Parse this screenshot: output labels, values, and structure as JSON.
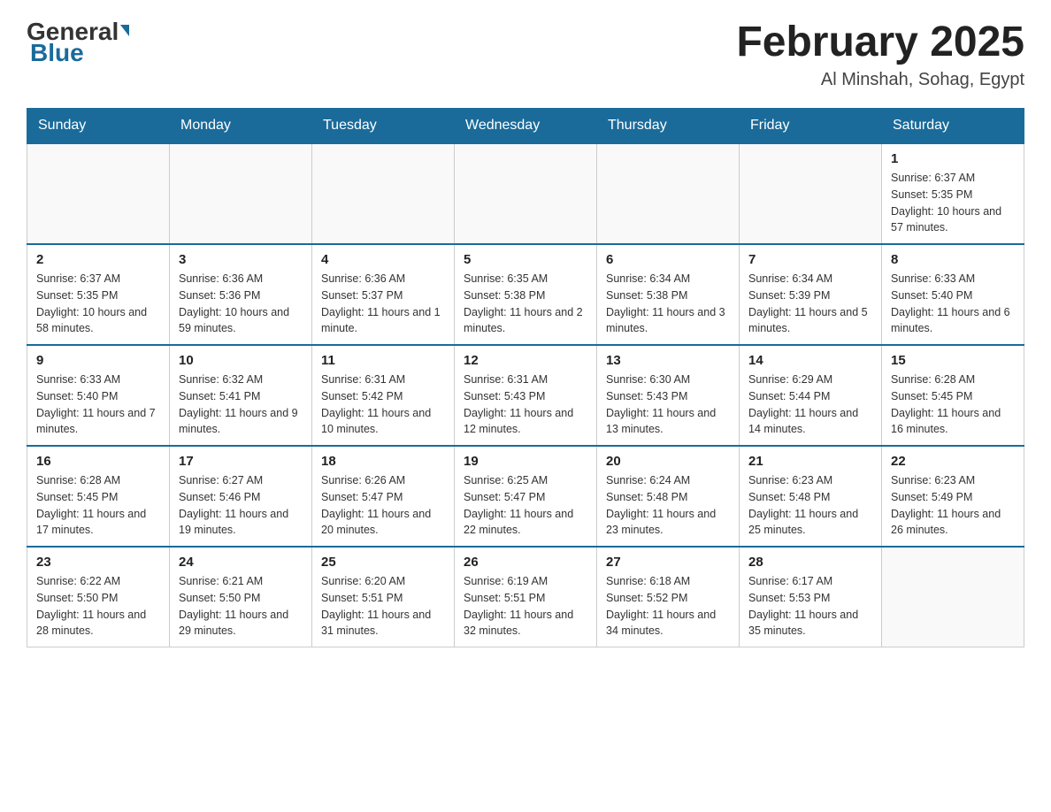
{
  "header": {
    "logo_general": "General",
    "logo_blue": "Blue",
    "month_year": "February 2025",
    "location": "Al Minshah, Sohag, Egypt"
  },
  "days_of_week": [
    "Sunday",
    "Monday",
    "Tuesday",
    "Wednesday",
    "Thursday",
    "Friday",
    "Saturday"
  ],
  "weeks": [
    [
      {
        "day": "",
        "info": ""
      },
      {
        "day": "",
        "info": ""
      },
      {
        "day": "",
        "info": ""
      },
      {
        "day": "",
        "info": ""
      },
      {
        "day": "",
        "info": ""
      },
      {
        "day": "",
        "info": ""
      },
      {
        "day": "1",
        "info": "Sunrise: 6:37 AM\nSunset: 5:35 PM\nDaylight: 10 hours and 57 minutes."
      }
    ],
    [
      {
        "day": "2",
        "info": "Sunrise: 6:37 AM\nSunset: 5:35 PM\nDaylight: 10 hours and 58 minutes."
      },
      {
        "day": "3",
        "info": "Sunrise: 6:36 AM\nSunset: 5:36 PM\nDaylight: 10 hours and 59 minutes."
      },
      {
        "day": "4",
        "info": "Sunrise: 6:36 AM\nSunset: 5:37 PM\nDaylight: 11 hours and 1 minute."
      },
      {
        "day": "5",
        "info": "Sunrise: 6:35 AM\nSunset: 5:38 PM\nDaylight: 11 hours and 2 minutes."
      },
      {
        "day": "6",
        "info": "Sunrise: 6:34 AM\nSunset: 5:38 PM\nDaylight: 11 hours and 3 minutes."
      },
      {
        "day": "7",
        "info": "Sunrise: 6:34 AM\nSunset: 5:39 PM\nDaylight: 11 hours and 5 minutes."
      },
      {
        "day": "8",
        "info": "Sunrise: 6:33 AM\nSunset: 5:40 PM\nDaylight: 11 hours and 6 minutes."
      }
    ],
    [
      {
        "day": "9",
        "info": "Sunrise: 6:33 AM\nSunset: 5:40 PM\nDaylight: 11 hours and 7 minutes."
      },
      {
        "day": "10",
        "info": "Sunrise: 6:32 AM\nSunset: 5:41 PM\nDaylight: 11 hours and 9 minutes."
      },
      {
        "day": "11",
        "info": "Sunrise: 6:31 AM\nSunset: 5:42 PM\nDaylight: 11 hours and 10 minutes."
      },
      {
        "day": "12",
        "info": "Sunrise: 6:31 AM\nSunset: 5:43 PM\nDaylight: 11 hours and 12 minutes."
      },
      {
        "day": "13",
        "info": "Sunrise: 6:30 AM\nSunset: 5:43 PM\nDaylight: 11 hours and 13 minutes."
      },
      {
        "day": "14",
        "info": "Sunrise: 6:29 AM\nSunset: 5:44 PM\nDaylight: 11 hours and 14 minutes."
      },
      {
        "day": "15",
        "info": "Sunrise: 6:28 AM\nSunset: 5:45 PM\nDaylight: 11 hours and 16 minutes."
      }
    ],
    [
      {
        "day": "16",
        "info": "Sunrise: 6:28 AM\nSunset: 5:45 PM\nDaylight: 11 hours and 17 minutes."
      },
      {
        "day": "17",
        "info": "Sunrise: 6:27 AM\nSunset: 5:46 PM\nDaylight: 11 hours and 19 minutes."
      },
      {
        "day": "18",
        "info": "Sunrise: 6:26 AM\nSunset: 5:47 PM\nDaylight: 11 hours and 20 minutes."
      },
      {
        "day": "19",
        "info": "Sunrise: 6:25 AM\nSunset: 5:47 PM\nDaylight: 11 hours and 22 minutes."
      },
      {
        "day": "20",
        "info": "Sunrise: 6:24 AM\nSunset: 5:48 PM\nDaylight: 11 hours and 23 minutes."
      },
      {
        "day": "21",
        "info": "Sunrise: 6:23 AM\nSunset: 5:48 PM\nDaylight: 11 hours and 25 minutes."
      },
      {
        "day": "22",
        "info": "Sunrise: 6:23 AM\nSunset: 5:49 PM\nDaylight: 11 hours and 26 minutes."
      }
    ],
    [
      {
        "day": "23",
        "info": "Sunrise: 6:22 AM\nSunset: 5:50 PM\nDaylight: 11 hours and 28 minutes."
      },
      {
        "day": "24",
        "info": "Sunrise: 6:21 AM\nSunset: 5:50 PM\nDaylight: 11 hours and 29 minutes."
      },
      {
        "day": "25",
        "info": "Sunrise: 6:20 AM\nSunset: 5:51 PM\nDaylight: 11 hours and 31 minutes."
      },
      {
        "day": "26",
        "info": "Sunrise: 6:19 AM\nSunset: 5:51 PM\nDaylight: 11 hours and 32 minutes."
      },
      {
        "day": "27",
        "info": "Sunrise: 6:18 AM\nSunset: 5:52 PM\nDaylight: 11 hours and 34 minutes."
      },
      {
        "day": "28",
        "info": "Sunrise: 6:17 AM\nSunset: 5:53 PM\nDaylight: 11 hours and 35 minutes."
      },
      {
        "day": "",
        "info": ""
      }
    ]
  ]
}
